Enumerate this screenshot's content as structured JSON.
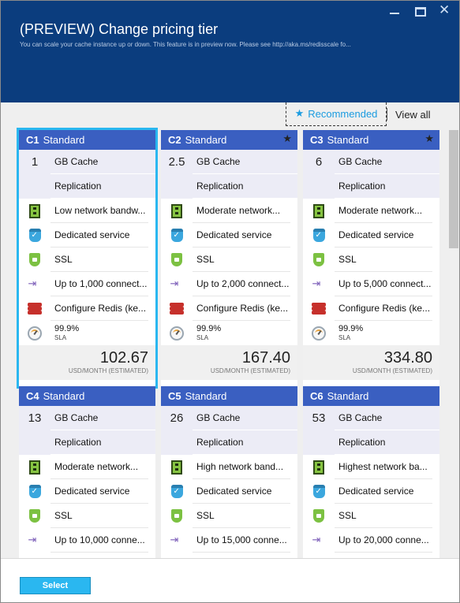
{
  "window": {
    "title": "(PREVIEW) Change pricing tier",
    "subtitle": "You can scale your cache instance up or down. This feature is in preview now. Please see http://aka.ms/redisscale fo...",
    "controls": [
      "minimize-icon",
      "maximize-icon",
      "close-icon"
    ]
  },
  "filter": {
    "recommended_label": "Recommended",
    "view_all_label": "View all"
  },
  "colors": {
    "header_bg": "#0b3d7e",
    "tier_header": "#3a5fc1",
    "accent": "#2ab7f0",
    "selected_outline": "#2ab7f0"
  },
  "tiers": [
    {
      "code": "C1",
      "name": "Standard",
      "starred": false,
      "selected": true,
      "cache_size": "1",
      "cache_label": "GB Cache",
      "replication": "Replication",
      "network": "Low network bandw...",
      "dedicated": "Dedicated service",
      "ssl": "SSL",
      "connections": "Up to 1,000 connect...",
      "redis": "Configure Redis (ke...",
      "sla_value": "99.9%",
      "sla_label": "SLA",
      "price": "102.67",
      "price_unit": "USD/MONTH (ESTIMATED)"
    },
    {
      "code": "C2",
      "name": "Standard",
      "starred": true,
      "selected": false,
      "cache_size": "2.5",
      "cache_label": "GB Cache",
      "replication": "Replication",
      "network": "Moderate network...",
      "dedicated": "Dedicated service",
      "ssl": "SSL",
      "connections": "Up to 2,000 connect...",
      "redis": "Configure Redis (ke...",
      "sla_value": "99.9%",
      "sla_label": "SLA",
      "price": "167.40",
      "price_unit": "USD/MONTH (ESTIMATED)"
    },
    {
      "code": "C3",
      "name": "Standard",
      "starred": true,
      "selected": false,
      "cache_size": "6",
      "cache_label": "GB Cache",
      "replication": "Replication",
      "network": "Moderate network...",
      "dedicated": "Dedicated service",
      "ssl": "SSL",
      "connections": "Up to 5,000 connect...",
      "redis": "Configure Redis (ke...",
      "sla_value": "99.9%",
      "sla_label": "SLA",
      "price": "334.80",
      "price_unit": "USD/MONTH (ESTIMATED)"
    },
    {
      "code": "C4",
      "name": "Standard",
      "starred": false,
      "selected": false,
      "cache_size": "13",
      "cache_label": "GB Cache",
      "replication": "Replication",
      "network": "Moderate network...",
      "dedicated": "Dedicated service",
      "ssl": "SSL",
      "connections": "Up to 10,000 conne..."
    },
    {
      "code": "C5",
      "name": "Standard",
      "starred": false,
      "selected": false,
      "cache_size": "26",
      "cache_label": "GB Cache",
      "replication": "Replication",
      "network": "High network band...",
      "dedicated": "Dedicated service",
      "ssl": "SSL",
      "connections": "Up to 15,000 conne..."
    },
    {
      "code": "C6",
      "name": "Standard",
      "starred": false,
      "selected": false,
      "cache_size": "53",
      "cache_label": "GB Cache",
      "replication": "Replication",
      "network": "Highest network ba...",
      "dedicated": "Dedicated service",
      "ssl": "SSL",
      "connections": "Up to 20,000 conne..."
    }
  ],
  "footer": {
    "select_label": "Select"
  }
}
